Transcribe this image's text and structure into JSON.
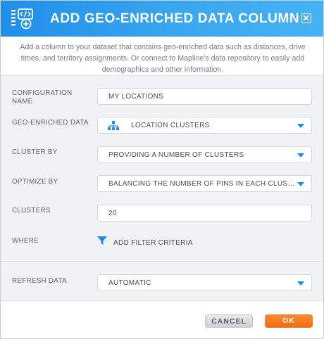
{
  "dialog": {
    "title": "ADD GEO-ENRICHED DATA COLUMN",
    "description": "Add a column to your dataset that contains geo-enriched data such as distances, drive times, and territory assignments. Or connect to Mapline's data repository to easily add demographics and other information."
  },
  "form": {
    "configuration_name": {
      "label": "CONFIGURATION NAME",
      "value": "MY LOCATIONS"
    },
    "geo_enriched_data": {
      "label": "GEO-ENRICHED DATA",
      "value": "LOCATION CLUSTERS",
      "icon": "cluster-hierarchy-icon"
    },
    "cluster_by": {
      "label": "CLUSTER BY",
      "value": "PROVIDING A NUMBER OF CLUSTERS"
    },
    "optimize_by": {
      "label": "OPTIMIZE BY",
      "value": "BALANCING THE NUMBER OF PINS IN EACH CLUSTER"
    },
    "clusters": {
      "label": "CLUSTERS",
      "value": "20"
    },
    "where": {
      "label": "WHERE",
      "link_label": "ADD FILTER CRITERIA",
      "icon": "filter-funnel-icon"
    },
    "refresh_data": {
      "label": "REFRESH DATA",
      "value": "AUTOMATIC"
    }
  },
  "buttons": {
    "cancel": "CANCEL",
    "ok": "OK"
  },
  "colors": {
    "header_start": "#1f8fe8",
    "header_end": "#45b3f3",
    "accent": "#1e8de6",
    "ok_button": "#f27518",
    "panel_background": "#f1f2f4"
  }
}
